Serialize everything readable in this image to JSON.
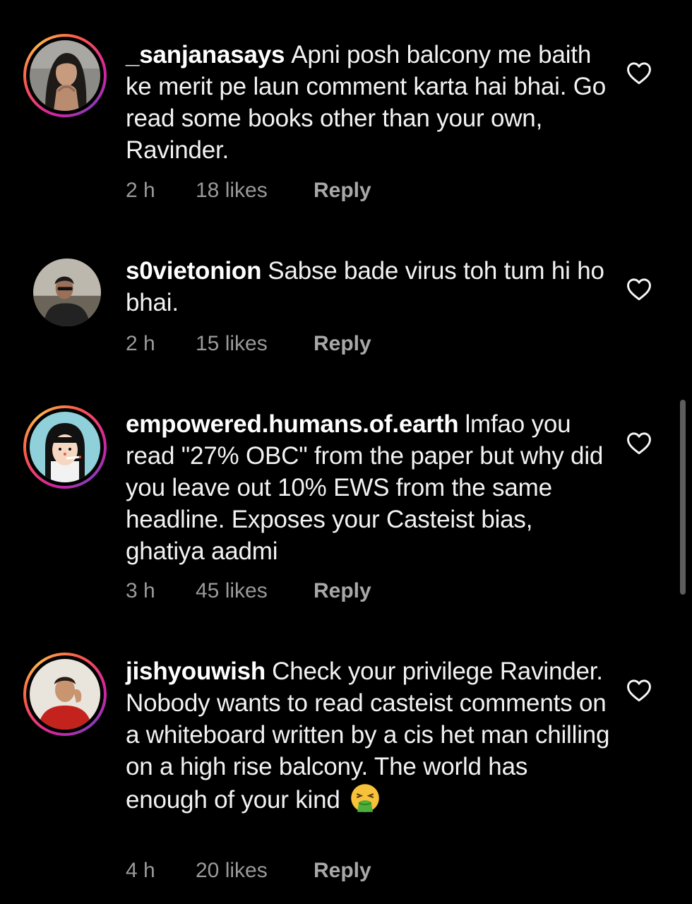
{
  "comments": [
    {
      "username": "_sanjanasays",
      "text": "Apni posh balcony me baith ke merit pe laun comment karta hai bhai. Go read some books other than your own, Ravinder.",
      "time": "2 h",
      "likes": "18 likes",
      "reply": "Reply",
      "story_ring": true
    },
    {
      "username": "s0vietonion",
      "text": "Sabse bade virus toh tum hi ho bhai.",
      "time": "2 h",
      "likes": "15 likes",
      "reply": "Reply",
      "story_ring": false
    },
    {
      "username": "empowered.humans.of.earth",
      "text": "lmfao you read \"27% OBC\" from the paper but why did you leave out 10% EWS from the same headline. Exposes your Casteist bias, ghatiya aadmi",
      "time": "3 h",
      "likes": "45 likes",
      "reply": "Reply",
      "story_ring": true
    },
    {
      "username": "jishyouwish",
      "text": "Check your privilege Ravinder. Nobody wants to read casteist comments on a whiteboard written by a cis het man chilling on a high rise balcony. The world has enough of your kind",
      "emoji": "vomiting-face-emoji",
      "time": "4 h",
      "likes": "20 likes",
      "reply": "Reply",
      "story_ring": true
    }
  ],
  "icons": {
    "like": "heart-outline-icon"
  },
  "colors": {
    "background": "#000000",
    "text": "#f2f2f2",
    "meta": "#9a9a9a"
  }
}
